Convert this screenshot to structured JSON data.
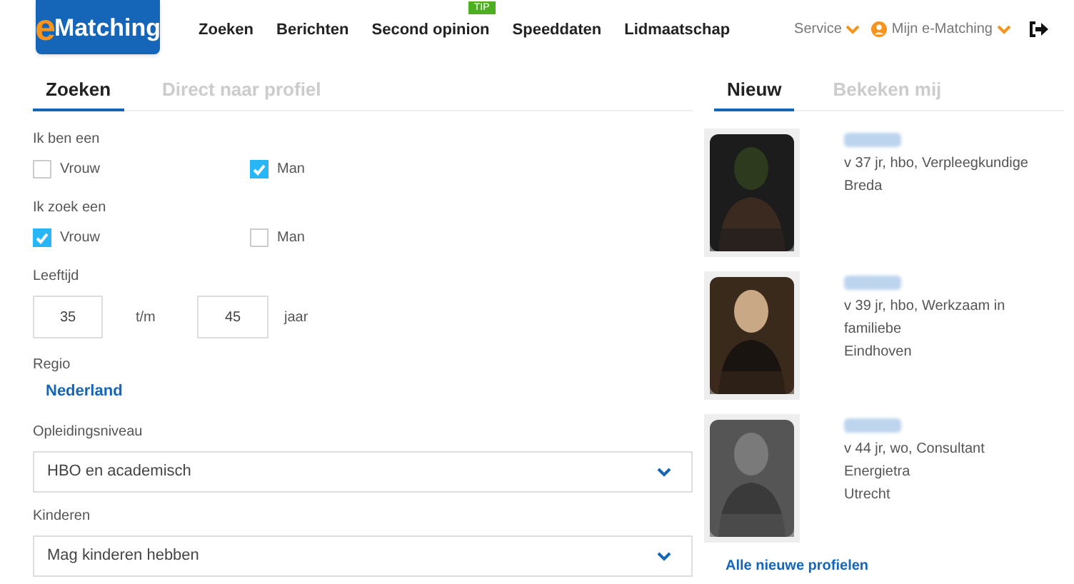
{
  "logo": {
    "first": "e",
    "rest": "Matching"
  },
  "nav": [
    {
      "label": "Zoeken"
    },
    {
      "label": "Berichten"
    },
    {
      "label": "Second opinion",
      "badge": "TIP"
    },
    {
      "label": "Speeddaten"
    },
    {
      "label": "Lidmaatschap"
    }
  ],
  "account": {
    "service": "Service",
    "user": "Mijn e-Matching"
  },
  "search_tabs": [
    {
      "label": "Zoeken",
      "selected": true
    },
    {
      "label": "Direct naar profiel",
      "selected": false
    }
  ],
  "form": {
    "i_am": {
      "label": "Ik ben een",
      "options": [
        {
          "label": "Vrouw",
          "checked": false
        },
        {
          "label": "Man",
          "checked": true
        }
      ]
    },
    "looking_for": {
      "label": "Ik zoek een",
      "options": [
        {
          "label": "Vrouw",
          "checked": true
        },
        {
          "label": "Man",
          "checked": false
        }
      ]
    },
    "age": {
      "label": "Leeftijd",
      "from": "35",
      "separator": "t/m",
      "to": "45",
      "unit": "jaar"
    },
    "region": {
      "label": "Regio",
      "value": "Nederland"
    },
    "education": {
      "label": "Opleidingsniveau",
      "value": "HBO en academisch"
    },
    "children": {
      "label": "Kinderen",
      "value": "Mag kinderen hebben"
    }
  },
  "profile_tabs": [
    {
      "label": "Nieuw",
      "selected": true
    },
    {
      "label": "Bekeken mij",
      "selected": false
    }
  ],
  "profiles": [
    {
      "kind": "picture",
      "lines": [
        "v 37 jr, hbo, Verpleegkundige",
        "Breda"
      ]
    },
    {
      "kind": "picture",
      "lines": [
        "v 39 jr, hbo, Werkzaam in familiebe",
        "Eindhoven"
      ]
    },
    {
      "kind": "picture",
      "lines": [
        "v 44 jr, wo, Consultant Energietra",
        "Utrecht"
      ]
    }
  ],
  "all_link": "Alle nieuwe profielen"
}
